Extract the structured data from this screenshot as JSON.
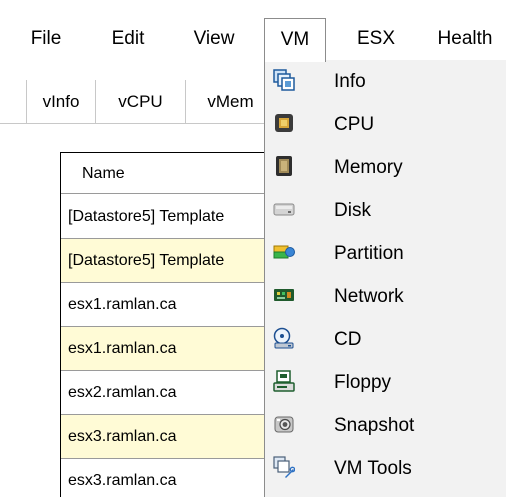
{
  "menubar": {
    "items": [
      {
        "label": "File"
      },
      {
        "label": "Edit"
      },
      {
        "label": "View"
      },
      {
        "label": "VM"
      },
      {
        "label": "ESX"
      },
      {
        "label": "Health"
      }
    ]
  },
  "tabs": [
    {
      "label": "vInfo"
    },
    {
      "label": "vCPU"
    },
    {
      "label": "vMem"
    }
  ],
  "grid": {
    "header": "Name",
    "rows": [
      {
        "name": "[Datastore5] Template"
      },
      {
        "name": "[Datastore5] Template"
      },
      {
        "name": "esx1.ramlan.ca"
      },
      {
        "name": "esx1.ramlan.ca"
      },
      {
        "name": "esx2.ramlan.ca"
      },
      {
        "name": "esx3.ramlan.ca"
      },
      {
        "name": "esx3.ramlan.ca"
      }
    ],
    "alt_row_color": "#fffbd6"
  },
  "vm_menu": {
    "items": [
      {
        "label": "Info",
        "icon": "info-icon"
      },
      {
        "label": "CPU",
        "icon": "cpu-icon"
      },
      {
        "label": "Memory",
        "icon": "memory-icon"
      },
      {
        "label": "Disk",
        "icon": "disk-icon"
      },
      {
        "label": "Partition",
        "icon": "partition-icon"
      },
      {
        "label": "Network",
        "icon": "network-icon"
      },
      {
        "label": "CD",
        "icon": "cd-icon"
      },
      {
        "label": "Floppy",
        "icon": "floppy-icon"
      },
      {
        "label": "Snapshot",
        "icon": "snapshot-icon"
      },
      {
        "label": "VM Tools",
        "icon": "vm-tools-icon"
      }
    ]
  }
}
